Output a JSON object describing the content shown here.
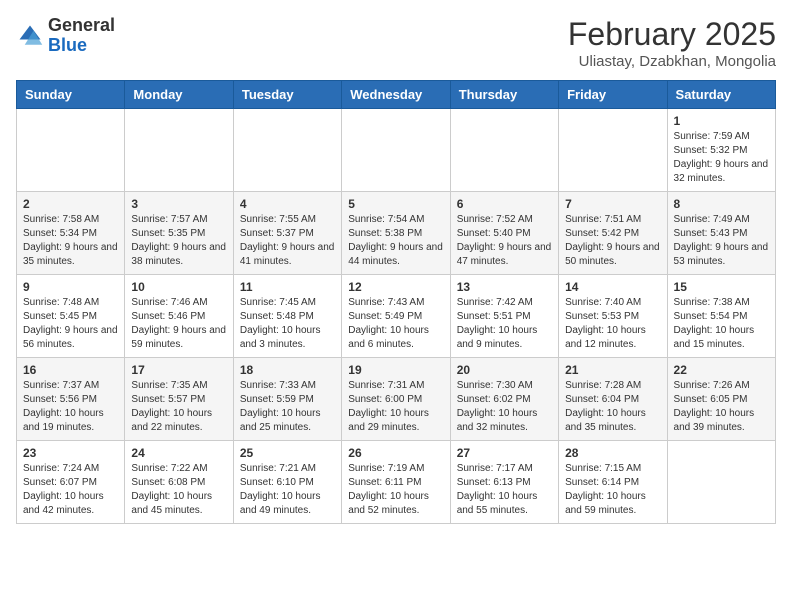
{
  "header": {
    "logo_general": "General",
    "logo_blue": "Blue",
    "month_title": "February 2025",
    "location": "Uliastay, Dzabkhan, Mongolia"
  },
  "days_of_week": [
    "Sunday",
    "Monday",
    "Tuesday",
    "Wednesday",
    "Thursday",
    "Friday",
    "Saturday"
  ],
  "weeks": [
    [
      {
        "day": "",
        "info": ""
      },
      {
        "day": "",
        "info": ""
      },
      {
        "day": "",
        "info": ""
      },
      {
        "day": "",
        "info": ""
      },
      {
        "day": "",
        "info": ""
      },
      {
        "day": "",
        "info": ""
      },
      {
        "day": "1",
        "info": "Sunrise: 7:59 AM\nSunset: 5:32 PM\nDaylight: 9 hours and 32 minutes."
      }
    ],
    [
      {
        "day": "2",
        "info": "Sunrise: 7:58 AM\nSunset: 5:34 PM\nDaylight: 9 hours and 35 minutes."
      },
      {
        "day": "3",
        "info": "Sunrise: 7:57 AM\nSunset: 5:35 PM\nDaylight: 9 hours and 38 minutes."
      },
      {
        "day": "4",
        "info": "Sunrise: 7:55 AM\nSunset: 5:37 PM\nDaylight: 9 hours and 41 minutes."
      },
      {
        "day": "5",
        "info": "Sunrise: 7:54 AM\nSunset: 5:38 PM\nDaylight: 9 hours and 44 minutes."
      },
      {
        "day": "6",
        "info": "Sunrise: 7:52 AM\nSunset: 5:40 PM\nDaylight: 9 hours and 47 minutes."
      },
      {
        "day": "7",
        "info": "Sunrise: 7:51 AM\nSunset: 5:42 PM\nDaylight: 9 hours and 50 minutes."
      },
      {
        "day": "8",
        "info": "Sunrise: 7:49 AM\nSunset: 5:43 PM\nDaylight: 9 hours and 53 minutes."
      }
    ],
    [
      {
        "day": "9",
        "info": "Sunrise: 7:48 AM\nSunset: 5:45 PM\nDaylight: 9 hours and 56 minutes."
      },
      {
        "day": "10",
        "info": "Sunrise: 7:46 AM\nSunset: 5:46 PM\nDaylight: 9 hours and 59 minutes."
      },
      {
        "day": "11",
        "info": "Sunrise: 7:45 AM\nSunset: 5:48 PM\nDaylight: 10 hours and 3 minutes."
      },
      {
        "day": "12",
        "info": "Sunrise: 7:43 AM\nSunset: 5:49 PM\nDaylight: 10 hours and 6 minutes."
      },
      {
        "day": "13",
        "info": "Sunrise: 7:42 AM\nSunset: 5:51 PM\nDaylight: 10 hours and 9 minutes."
      },
      {
        "day": "14",
        "info": "Sunrise: 7:40 AM\nSunset: 5:53 PM\nDaylight: 10 hours and 12 minutes."
      },
      {
        "day": "15",
        "info": "Sunrise: 7:38 AM\nSunset: 5:54 PM\nDaylight: 10 hours and 15 minutes."
      }
    ],
    [
      {
        "day": "16",
        "info": "Sunrise: 7:37 AM\nSunset: 5:56 PM\nDaylight: 10 hours and 19 minutes."
      },
      {
        "day": "17",
        "info": "Sunrise: 7:35 AM\nSunset: 5:57 PM\nDaylight: 10 hours and 22 minutes."
      },
      {
        "day": "18",
        "info": "Sunrise: 7:33 AM\nSunset: 5:59 PM\nDaylight: 10 hours and 25 minutes."
      },
      {
        "day": "19",
        "info": "Sunrise: 7:31 AM\nSunset: 6:00 PM\nDaylight: 10 hours and 29 minutes."
      },
      {
        "day": "20",
        "info": "Sunrise: 7:30 AM\nSunset: 6:02 PM\nDaylight: 10 hours and 32 minutes."
      },
      {
        "day": "21",
        "info": "Sunrise: 7:28 AM\nSunset: 6:04 PM\nDaylight: 10 hours and 35 minutes."
      },
      {
        "day": "22",
        "info": "Sunrise: 7:26 AM\nSunset: 6:05 PM\nDaylight: 10 hours and 39 minutes."
      }
    ],
    [
      {
        "day": "23",
        "info": "Sunrise: 7:24 AM\nSunset: 6:07 PM\nDaylight: 10 hours and 42 minutes."
      },
      {
        "day": "24",
        "info": "Sunrise: 7:22 AM\nSunset: 6:08 PM\nDaylight: 10 hours and 45 minutes."
      },
      {
        "day": "25",
        "info": "Sunrise: 7:21 AM\nSunset: 6:10 PM\nDaylight: 10 hours and 49 minutes."
      },
      {
        "day": "26",
        "info": "Sunrise: 7:19 AM\nSunset: 6:11 PM\nDaylight: 10 hours and 52 minutes."
      },
      {
        "day": "27",
        "info": "Sunrise: 7:17 AM\nSunset: 6:13 PM\nDaylight: 10 hours and 55 minutes."
      },
      {
        "day": "28",
        "info": "Sunrise: 7:15 AM\nSunset: 6:14 PM\nDaylight: 10 hours and 59 minutes."
      },
      {
        "day": "",
        "info": ""
      }
    ]
  ]
}
